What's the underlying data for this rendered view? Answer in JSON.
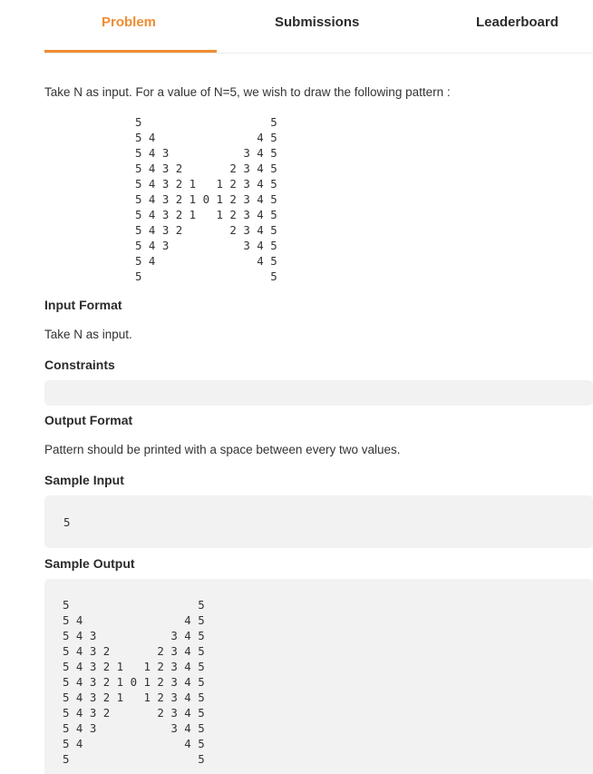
{
  "tabs": [
    {
      "label": "Problem",
      "active": true
    },
    {
      "label": "Submissions",
      "active": false
    },
    {
      "label": "Leaderboard",
      "active": false
    }
  ],
  "problem": {
    "intro": "Take N as input. For a value of N=5, we wish to draw the following pattern :",
    "pattern": "5         5\n5 4     4 5\n5 4 3     3 4 5\n5 4 3 2     2 3 4 5\n5 4 3 2 1   1 2 3 4 5\n5 4 3 2 1 0 1 2 3 4 5\n5 4 3 2 1   1 2 3 4 5\n5 4 3 2     2 3 4 5\n5 4 3     3 4 5\n5 4     4 5\n5         5"
  },
  "sections": {
    "input_format": {
      "title": "Input Format",
      "text": "Take N as input."
    },
    "constraints": {
      "title": "Constraints",
      "text": ""
    },
    "output_format": {
      "title": "Output Format",
      "text": "Pattern should be printed with a space between every two values."
    },
    "sample_input": {
      "title": "Sample Input",
      "value": "5"
    },
    "sample_output": {
      "title": "Sample Output",
      "value": "5                   5\n5 4               4 5\n5 4 3           3 4 5\n5 4 3 2       2 3 4 5\n5 4 3 2 1   1 2 3 4 5\n5 4 3 2 1 0 1 2 3 4 5\n5 4 3 2 1   1 2 3 4 5\n5 4 3 2       2 3 4 5\n5 4 3           3 4 5\n5 4               4 5\n5                   5"
    }
  },
  "colors": {
    "accent": "#f08c33",
    "box_background": "#f2f2f2"
  }
}
